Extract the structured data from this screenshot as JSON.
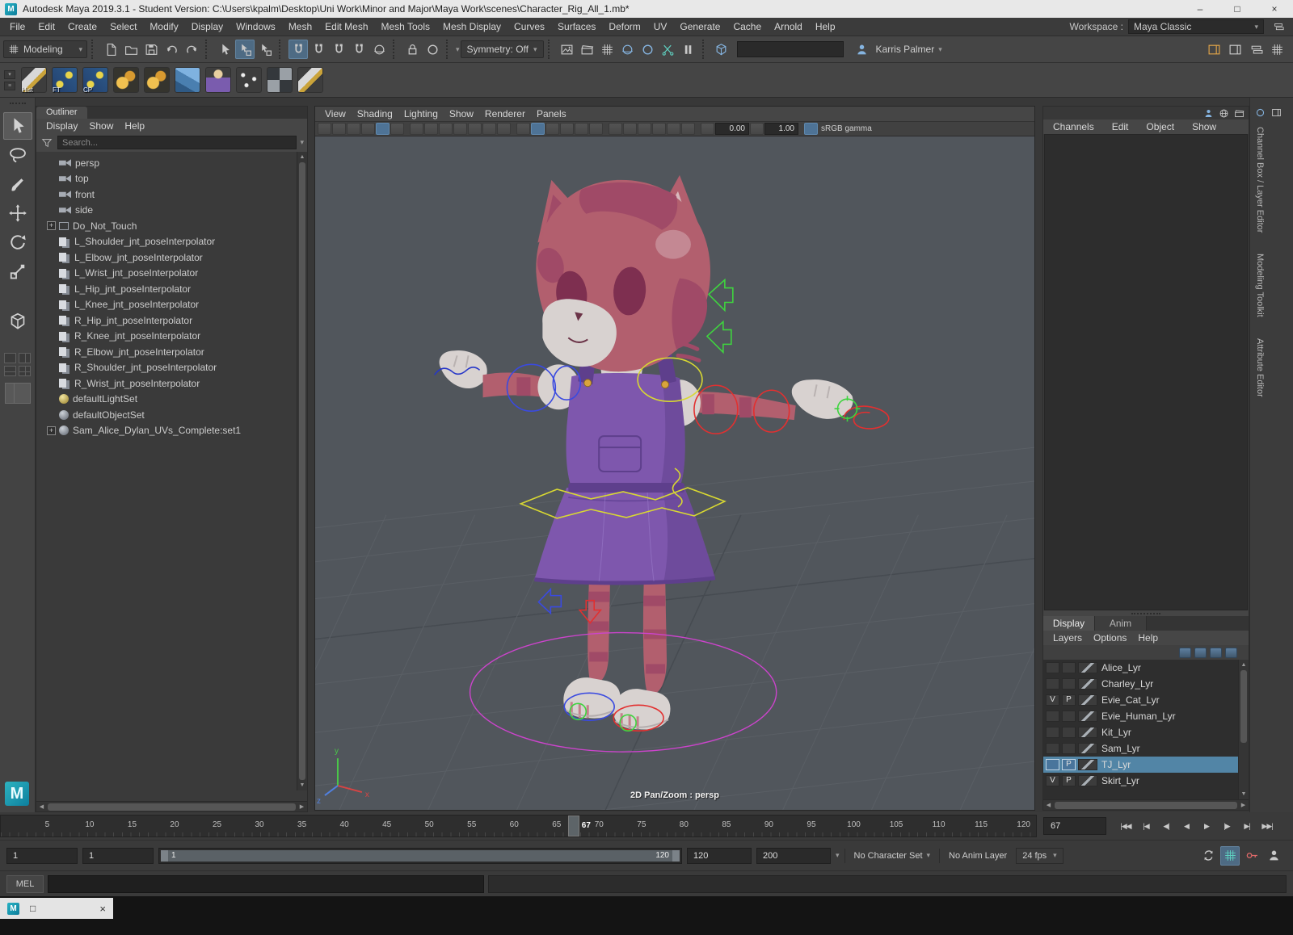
{
  "titlebar": {
    "title": "Autodesk Maya 2019.3.1 - Student Version: C:\\Users\\kpalm\\Desktop\\Uni Work\\Minor and Major\\Maya Work\\scenes\\Character_Rig_All_1.mb*",
    "minimize": "–",
    "maximize": "□",
    "close": "×"
  },
  "menubar": {
    "items": [
      "File",
      "Edit",
      "Create",
      "Select",
      "Modify",
      "Display",
      "Windows",
      "Mesh",
      "Edit Mesh",
      "Mesh Tools",
      "Mesh Display",
      "Curves",
      "Surfaces",
      "Deform",
      "UV",
      "Generate",
      "Cache",
      "Arnold",
      "Help"
    ],
    "workspace_label": "Workspace :",
    "workspace_value": "Maya Classic"
  },
  "statusline": {
    "mode": "Modeling",
    "symmetry_label": "Symmetry: Off",
    "user_name": "Karris Palmer",
    "input_value": ""
  },
  "shelf": {
    "items": [
      {
        "label": "Hist",
        "icon": "pencil"
      },
      {
        "label": "FT",
        "icon": "joint"
      },
      {
        "label": "CP",
        "icon": "joint"
      },
      {
        "label": "",
        "icon": "spheres"
      },
      {
        "label": "",
        "icon": "spheres"
      },
      {
        "label": "",
        "icon": "cube"
      },
      {
        "label": "",
        "icon": "figure"
      },
      {
        "label": "",
        "icon": "dots"
      },
      {
        "label": "",
        "icon": "checker"
      },
      {
        "label": "",
        "icon": "pencil"
      }
    ]
  },
  "outliner": {
    "tab_title": "Outliner",
    "menus": [
      "Display",
      "Show",
      "Help"
    ],
    "search_placeholder": "Search...",
    "items": [
      {
        "label": "persp",
        "icon": "camera",
        "exp": ""
      },
      {
        "label": "top",
        "icon": "camera",
        "exp": ""
      },
      {
        "label": "front",
        "icon": "camera",
        "exp": ""
      },
      {
        "label": "side",
        "icon": "camera",
        "exp": ""
      },
      {
        "label": "Do_Not_Touch",
        "icon": "group",
        "exp": "+"
      },
      {
        "label": "L_Shoulder_jnt_poseInterpolator",
        "icon": "pose",
        "exp": ""
      },
      {
        "label": "L_Elbow_jnt_poseInterpolator",
        "icon": "pose",
        "exp": ""
      },
      {
        "label": "L_Wrist_jnt_poseInterpolator",
        "icon": "pose",
        "exp": ""
      },
      {
        "label": "L_Hip_jnt_poseInterpolator",
        "icon": "pose",
        "exp": ""
      },
      {
        "label": "L_Knee_jnt_poseInterpolator",
        "icon": "pose",
        "exp": ""
      },
      {
        "label": "R_Hip_jnt_poseInterpolator",
        "icon": "pose",
        "exp": ""
      },
      {
        "label": "R_Knee_jnt_poseInterpolator",
        "icon": "pose",
        "exp": ""
      },
      {
        "label": "R_Elbow_jnt_poseInterpolator",
        "icon": "pose",
        "exp": ""
      },
      {
        "label": "R_Shoulder_jnt_poseInterpolator",
        "icon": "pose",
        "exp": ""
      },
      {
        "label": "R_Wrist_jnt_poseInterpolator",
        "icon": "pose",
        "exp": ""
      },
      {
        "label": "defaultLightSet",
        "icon": "light",
        "exp": ""
      },
      {
        "label": "defaultObjectSet",
        "icon": "set",
        "exp": ""
      },
      {
        "label": "Sam_Alice_Dylan_UVs_Complete:set1",
        "icon": "set",
        "exp": "+"
      }
    ]
  },
  "viewport": {
    "menus": [
      "View",
      "Shading",
      "Lighting",
      "Show",
      "Renderer",
      "Panels"
    ],
    "exposure_value": "0.00",
    "gamma_value": "1.00",
    "color_mgmt": "sRGB gamma",
    "overlay_label": "2D Pan/Zoom : persp"
  },
  "channel_box": {
    "menus": [
      "Channels",
      "Edit",
      "Object",
      "Show"
    ],
    "side_tabs": [
      "Channel Box / Layer Editor",
      "Modeling Toolkit",
      "Attribute Editor"
    ]
  },
  "layer_editor": {
    "tabs": [
      "Display",
      "Anim"
    ],
    "menus": [
      "Layers",
      "Options",
      "Help"
    ],
    "layers": [
      {
        "v": "",
        "p": "",
        "name": "Alice_Lyr",
        "sel": ""
      },
      {
        "v": "",
        "p": "",
        "name": "Charley_Lyr",
        "sel": ""
      },
      {
        "v": "V",
        "p": "P",
        "name": "Evie_Cat_Lyr",
        "sel": ""
      },
      {
        "v": "",
        "p": "",
        "name": "Evie_Human_Lyr",
        "sel": ""
      },
      {
        "v": "",
        "p": "",
        "name": "Kit_Lyr",
        "sel": ""
      },
      {
        "v": "",
        "p": "",
        "name": "Sam_Lyr",
        "sel": ""
      },
      {
        "v": "",
        "p": "P",
        "name": "TJ_Lyr",
        "sel": "selected"
      },
      {
        "v": "V",
        "p": "P",
        "name": "Skirt_Lyr",
        "sel": ""
      }
    ]
  },
  "timeline": {
    "ticks": [
      "5",
      "10",
      "15",
      "20",
      "25",
      "30",
      "35",
      "40",
      "45",
      "50",
      "55",
      "60",
      "65",
      "70",
      "75",
      "80",
      "85",
      "90",
      "95",
      "100",
      "105",
      "110",
      "115",
      "120"
    ],
    "current_frame": "67",
    "playback_buttons": [
      "|◀◀",
      "|◀",
      "◀|",
      "◀",
      "▶",
      "|▶",
      "▶|",
      "▶▶|"
    ]
  },
  "range_slider": {
    "anim_start": "1",
    "playback_start": "1",
    "inner_start": "1",
    "inner_end": "120",
    "playback_end": "120",
    "anim_end": "200",
    "character_set": "No Character Set",
    "anim_layer": "No Anim Layer",
    "fps": "24 fps"
  },
  "command_line": {
    "label": "MEL",
    "input_value": "",
    "output_value": ""
  },
  "scene": {
    "colors": {
      "viewport_bg": "#51565c",
      "fur": "#b25f6e",
      "fur_dark": "#a04a67",
      "muzzle_white": "#d8d2d0",
      "dress": "#7e57ad",
      "dress_dark": "#5e3f8c",
      "control_yellow": "#d8d832",
      "control_green": "#3fd43f",
      "control_red": "#e23030",
      "control_blue": "#3a4ae0",
      "control_magenta": "#cc44cc",
      "selection_highlight": "#5285a6"
    }
  }
}
